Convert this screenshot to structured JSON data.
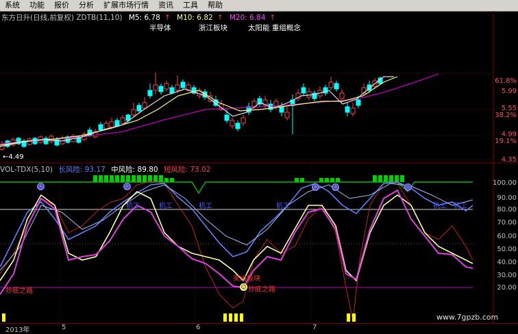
{
  "menu": [
    "系统",
    "功能",
    "报价",
    "分析",
    "扩展市场行情",
    "资讯",
    "工具",
    "帮助"
  ],
  "stock_header": {
    "name": "东方日升(日线,前复权) ZDTB(11,10)",
    "m5": "M5: 6.78",
    "m10": "M10: 6.82",
    "m20": "M20: 6.84"
  },
  "tags": [
    "半导体",
    "浙江板块",
    "太阳能 重组概念"
  ],
  "price_axis": {
    "labels": [
      "61.8%",
      "5.99",
      "5.55",
      "38.2%",
      "4.99",
      "19.1%",
      "4.35"
    ],
    "low_marker": "←4.49"
  },
  "indicator_header": {
    "name": "VOL-TDX(5,10)",
    "long_risk": "长风险: 93.17",
    "mid_risk": "中风险: 89.80",
    "short_risk": "短风险: 73.02"
  },
  "indicator_axis": [
    "100.00",
    "90.00",
    "80.00",
    "70.00",
    "60.00",
    "50.00",
    "40.00",
    "30.00",
    "20.00"
  ],
  "annotations": {
    "blue_labels": [
      "机工",
      "机工",
      "机工",
      "机工",
      "机工",
      "机工"
    ],
    "bottom_left": "抄底之路",
    "bottom_mid": "抄底之路",
    "mid_red": "卖出板块"
  },
  "dates": [
    "2013年",
    "5",
    "6",
    "7"
  ],
  "watermark": "www.7gpzb.com",
  "colors": {
    "background": "#000000",
    "up": "#ff4040",
    "down": "#00ffff",
    "ma5": "#ffffff",
    "ma10": "#ffff80",
    "ma20": "#ff00ff",
    "green_bar": "#00d000",
    "axis_red": "#800000"
  }
}
